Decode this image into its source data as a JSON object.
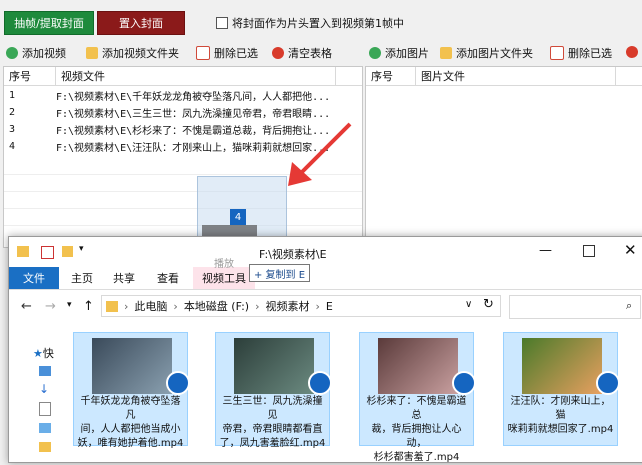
{
  "top": {
    "extract_btn": "抽帧/提取封面",
    "import_btn": "置入封面",
    "checkbox_label": "将封面作为片头置入到视频第1帧中"
  },
  "toolbar_left": {
    "add_video": "添加视频",
    "add_video_folder": "添加视频文件夹",
    "delete_selected": "删除已选",
    "clear_table": "清空表格"
  },
  "toolbar_right": {
    "add_image": "添加图片",
    "add_image_folder": "添加图片文件夹",
    "delete_selected": "删除已选"
  },
  "video_table": {
    "headers": [
      "序号",
      "视频文件"
    ],
    "rows": [
      {
        "no": "1",
        "file": "F:\\视频素材\\E\\千年妖龙龙角被夺坠落凡间，人人都把他..."
      },
      {
        "no": "2",
        "file": "F:\\视频素材\\E\\三生三世：凤九洗澡撞见帝君，帝君眼睛..."
      },
      {
        "no": "3",
        "file": "F:\\视频素材\\E\\杉杉来了：不愧是霸道总裁，背后拥抱让..."
      },
      {
        "no": "4",
        "file": "F:\\视频素材\\E\\汪汪队：才刚来山上，猫咪莉莉就想回家..."
      }
    ]
  },
  "image_table": {
    "headers": [
      "序号",
      "图片文件"
    ]
  },
  "drag": {
    "count": "4",
    "copy_to": "+ 复制到 E"
  },
  "explorer": {
    "title": "F:\\视频素材\\E",
    "ribbon_tabs": [
      "文件",
      "主页",
      "共享",
      "查看",
      "视频工具"
    ],
    "ribbon_ghost": "播放",
    "breadcrumb": [
      "此电脑",
      "本地磁盘 (F:)",
      "视频素材",
      "E"
    ],
    "nav_items": [
      "快",
      "",
      "",
      "文",
      "图",
      ""
    ],
    "files": [
      {
        "name": "千年妖龙龙角被夺坠落凡间，人人都把他当成小妖，唯有她护着他.mp4",
        "line1": "千年妖龙龙角被夺坠落凡",
        "line2": "间，人人都把他当成小",
        "line3": "妖，唯有她护着他.mp4"
      },
      {
        "name": "三生三世：凤九洗澡撞见帝君，帝君眼睛都看直了，凤九害羞脸红.mp4",
        "line1": "三生三世：凤九洗澡撞见",
        "line2": "帝君，帝君眼睛都看直",
        "line3": "了，凤九害羞脸红.mp4"
      },
      {
        "name": "杉杉来了：不愧是霸道总裁，背后拥抱让人心动，杉杉都害羞了.mp4",
        "line1": "杉杉来了：不愧是霸道总",
        "line2": "裁，背后拥抱让人心动，",
        "line3": "杉杉都害羞了.mp4"
      },
      {
        "name": "汪汪队：才刚来山上，猫咪莉莉就想回家了.mp4",
        "line1": "汪汪队：才刚来山上，猫",
        "line2": "咪莉莉就想回家了.mp4",
        "line3": ""
      }
    ]
  },
  "colors": {
    "green_button": "#1e8a3c",
    "red_button": "#8b1a1a",
    "explorer_tab_blue": "#1a6fc4",
    "selection": "#cce8ff",
    "arrow": "#e53935"
  }
}
